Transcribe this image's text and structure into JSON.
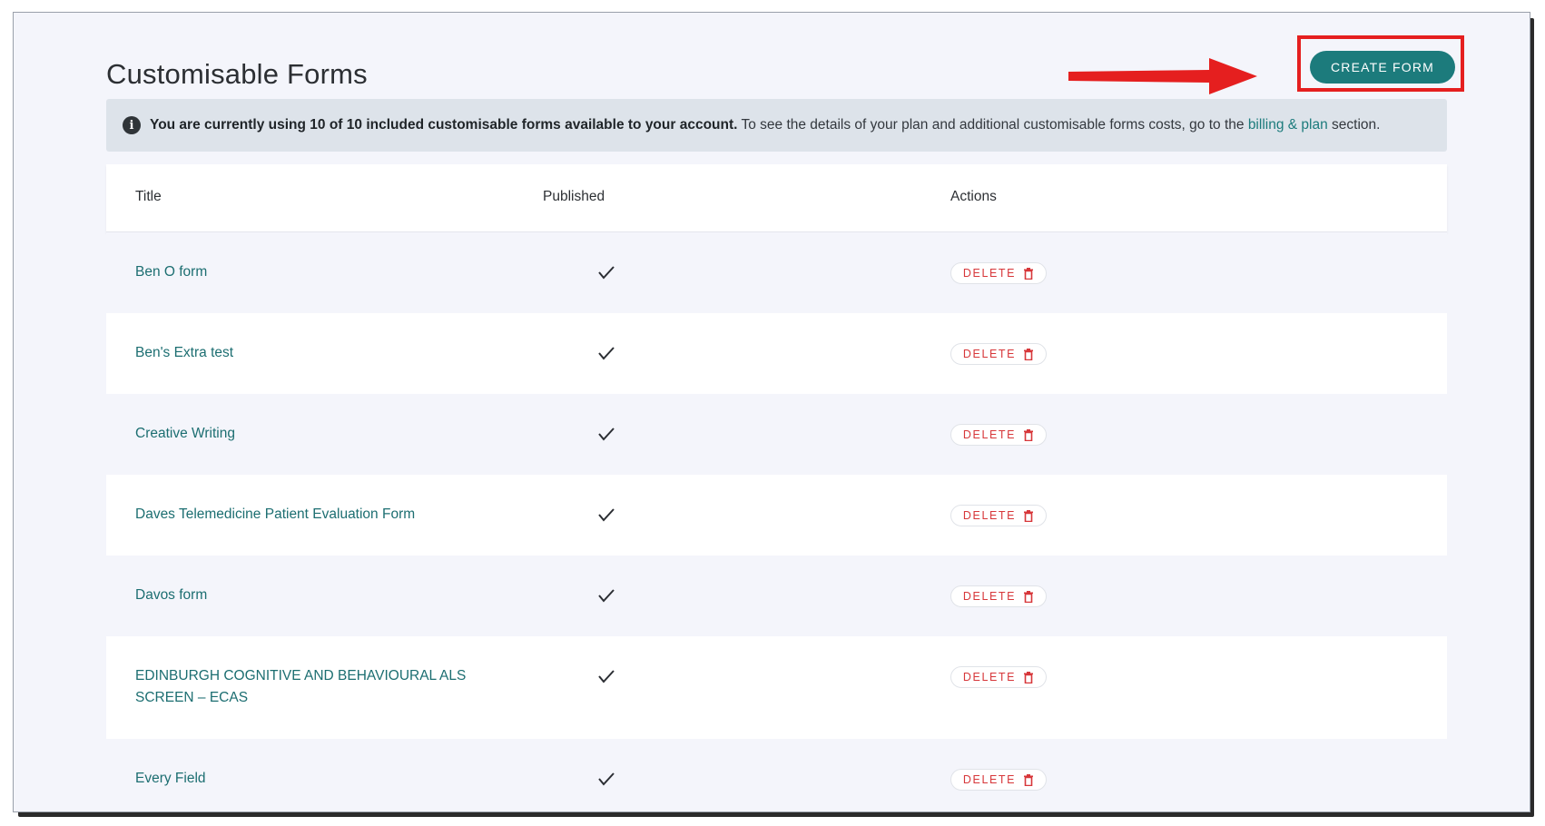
{
  "page": {
    "title": "Customisable Forms",
    "create_button_label": "CREATE FORM"
  },
  "banner": {
    "icon": "info-icon",
    "bold_text": "You are currently using 10 of 10 included customisable forms available to your account.",
    "text": " To see the details of your plan and additional customisable forms costs, go to the ",
    "link_text": "billing & plan",
    "suffix": " section."
  },
  "table": {
    "columns": {
      "title": "Title",
      "published": "Published",
      "actions": "Actions"
    },
    "delete_label": "DELETE",
    "rows": [
      {
        "title": "Ben O form",
        "published": true
      },
      {
        "title": "Ben's Extra test",
        "published": true
      },
      {
        "title": "Creative Writing",
        "published": true
      },
      {
        "title": "Daves Telemedicine Patient Evaluation Form",
        "published": true
      },
      {
        "title": "Davos form",
        "published": true
      },
      {
        "title": "EDINBURGH COGNITIVE AND BEHAVIOURAL ALS SCREEN – ECAS",
        "published": true
      },
      {
        "title": "Every Field",
        "published": true
      }
    ]
  },
  "colors": {
    "accent": "#1c7b7c",
    "delete": "#d7373a",
    "annotation": "#e51f1f"
  }
}
